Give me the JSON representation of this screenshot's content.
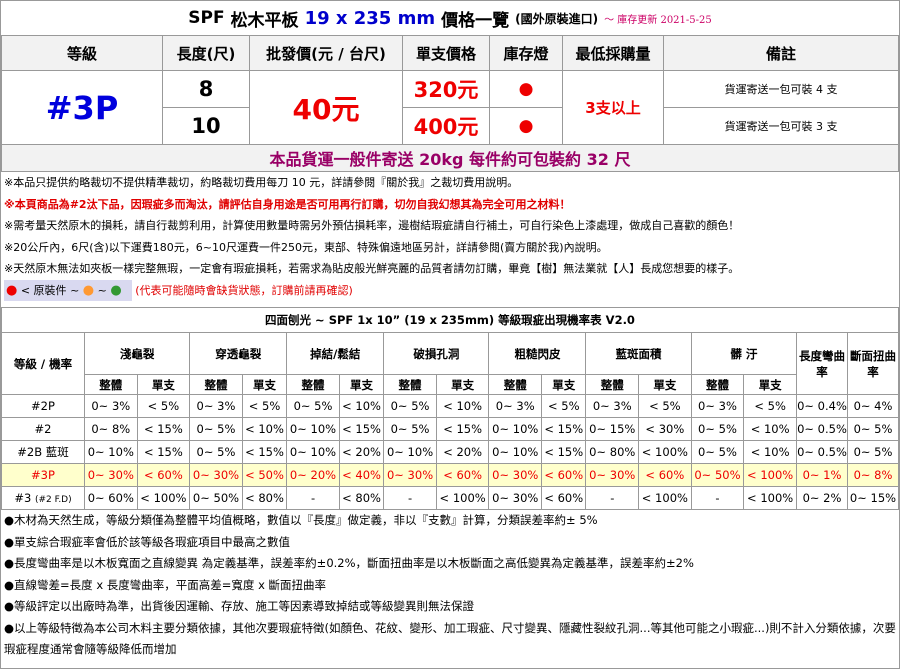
{
  "header": {
    "brand": "SPF",
    "product": "松木平板",
    "dims": "19 x 235 mm",
    "price_list": "價格一覽",
    "origin": "(國外原裝進口)",
    "updated": "～ 庫存更新 2021-5-25"
  },
  "price_table": {
    "headers": [
      "等級",
      "長度(尺)",
      "批發價(元 / 台尺)",
      "單支價格",
      "庫存燈",
      "最低採購量",
      "備註"
    ],
    "grade": "#3P",
    "wholesale": "40元",
    "min_qty": "3支以上",
    "rows": [
      {
        "length": "8",
        "unit_price": "320元",
        "stock": "●",
        "remark": "貨運寄送一包可裝 4 支"
      },
      {
        "length": "10",
        "unit_price": "400元",
        "stock": "●",
        "remark": "貨運寄送一包可裝 3 支"
      }
    ],
    "shipping_note": "本品貨運一般件寄送 20kg 每件約可包裝約 32 尺"
  },
  "notes": [
    "※本品只提供約略裁切不提供精準裁切，約略裁切費用每刀 10 元，詳請參閱『關於我』之裁切費用說明。",
    "※本頁商品為#2汰下品，因瑕疵多而淘汰，請評估自身用途是否可用再行訂購，切勿自我幻想其為完全可用之材料！",
    "※需考量天然原木的損耗，請自行裁剪利用，計算使用數量時需另外預估損耗率，邊樹結瑕疵請自行補土，可自行染色上漆處理，做成自己喜歡的顏色！",
    "※20公斤內，6尺(含)以下運費180元，6~10尺運費一件250元，東部、特殊偏遠地區另計，詳請參閱(賣方關於我)內說明。",
    "※天然原木無法如夾板一樣完整無瑕，一定會有瑕疵損耗，若需求為貼皮般光鮮亮麗的品質者請勿訂購，畢竟【樹】無法業就【人】長成您想要的樣子。"
  ],
  "legend": {
    "dots": [
      {
        "glyph": "●",
        "color": "#ee0000"
      },
      {
        "glyph": "●",
        "color": "#ff9933"
      },
      {
        "glyph": "●",
        "color": "#339933"
      }
    ],
    "label": "< 原裝件",
    "sep": "~",
    "warning": "(代表可能隨時會缺貨狀態，訂購前請再確認)"
  },
  "defect_table": {
    "title": "四面刨光 ~ SPF 1x 10”  (19 x 235mm) 等級瑕疵出現機率表 V2.0",
    "grade_header": "等級 / 機率",
    "groups": [
      "淺龜裂",
      "穿透龜裂",
      "掉結/鬆結",
      "破損孔洞",
      "粗糙閃皮",
      "藍斑面積",
      "髒 汙"
    ],
    "extra_headers": [
      "長度彎曲率",
      "斷面扭曲率"
    ],
    "sub": [
      "整體",
      "單支"
    ],
    "rows": [
      {
        "grade": "#2P",
        "vals": [
          "0~ 3%",
          "< 5%",
          "0~ 3%",
          "< 5%",
          "0~ 5%",
          "< 10%",
          "0~ 5%",
          "< 10%",
          "0~ 3%",
          "< 5%",
          "0~ 3%",
          "< 5%",
          "0~ 3%",
          "< 5%",
          "0~ 0.4%",
          "0~ 4%"
        ]
      },
      {
        "grade": "#2",
        "vals": [
          "0~ 8%",
          "< 15%",
          "0~ 5%",
          "< 10%",
          "0~ 10%",
          "< 15%",
          "0~ 5%",
          "< 15%",
          "0~ 10%",
          "< 15%",
          "0~ 15%",
          "< 30%",
          "0~ 5%",
          "< 10%",
          "0~ 0.5%",
          "0~ 5%"
        ]
      },
      {
        "grade": "#2B 藍斑",
        "vals": [
          "0~ 10%",
          "< 15%",
          "0~ 5%",
          "< 15%",
          "0~ 10%",
          "< 20%",
          "0~ 10%",
          "< 20%",
          "0~ 10%",
          "< 15%",
          "0~ 80%",
          "< 100%",
          "0~ 5%",
          "< 10%",
          "0~ 0.5%",
          "0~ 5%"
        ]
      },
      {
        "grade": "#3P",
        "vals": [
          "0~ 30%",
          "< 60%",
          "0~ 30%",
          "< 50%",
          "0~ 20%",
          "< 40%",
          "0~ 30%",
          "< 60%",
          "0~ 30%",
          "< 60%",
          "0~ 30%",
          "< 60%",
          "0~ 50%",
          "< 100%",
          "0~ 1%",
          "0~ 8%"
        ]
      },
      {
        "grade": "#3",
        "grade_sub": "(#2 F.D)",
        "vals": [
          "0~ 60%",
          "< 100%",
          "0~ 50%",
          "< 80%",
          "-",
          "< 80%",
          "-",
          "< 100%",
          "0~ 30%",
          "< 60%",
          "-",
          "< 100%",
          "-",
          "< 100%",
          "0~ 2%",
          "0~ 15%"
        ]
      }
    ]
  },
  "footnotes": [
    "●木材為天然生成，等級分類僅為整體平均值概略，數值以『長度』做定義，非以『支數』計算，分類誤差率約± 5%",
    "●單支綜合瑕疵率會低於該等級各瑕疵項目中最高之數值",
    "●長度彎曲率是以木板寬面之直線變異 為定義基準，誤差率約±0.2%，斷面扭曲率是以木板斷面之高低變異為定義基準，誤差率約±2%",
    "●直線彎差=長度 x 長度彎曲率，平面高差=寬度 x 斷面扭曲率",
    "●等級評定以出廠時為準，出貨後因運輸、存放、施工等因素導致掉結或等級變異則無法保證",
    "●以上等級特徵為本公司木料主要分類依據，其他次要瑕疵特徵(如顏色、花紋、變形、加工瑕疵、尺寸變異、隱藏性裂紋孔洞...等其他可能之小瑕疵...)則不計入分類依據，次要瑕疵程度通常會隨等級降低而增加"
  ]
}
